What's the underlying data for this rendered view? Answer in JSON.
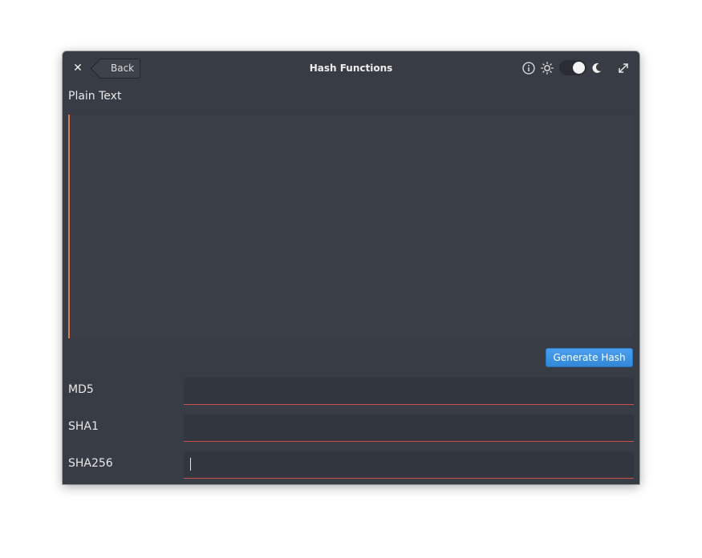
{
  "window": {
    "title": "Hash Functions",
    "back_label": "Back",
    "theme_toggle_dark": true
  },
  "icons": {
    "close": "close-icon",
    "info": "info-icon",
    "sun": "sun-icon",
    "moon": "moon-icon",
    "maximize": "maximize-icon"
  },
  "plain_text": {
    "label": "Plain Text",
    "value": ""
  },
  "generate_button": {
    "label": "Generate Hash"
  },
  "hashes": [
    {
      "label": "MD5",
      "value": ""
    },
    {
      "label": "SHA1",
      "value": ""
    },
    {
      "label": "SHA256",
      "value": ""
    }
  ],
  "colors": {
    "window_bg": "#383c44",
    "accent_button": "#3d8fe0",
    "focus_accent": "#e07a4f",
    "error_underline": "#cf5047"
  }
}
